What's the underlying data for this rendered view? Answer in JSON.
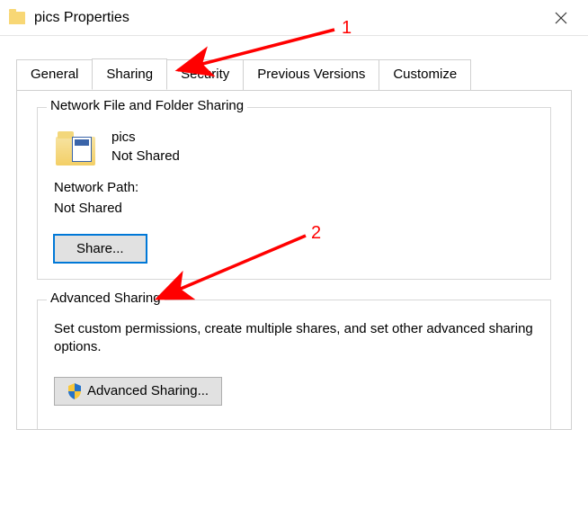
{
  "window": {
    "title": "pics Properties"
  },
  "tabs": {
    "general": "General",
    "sharing": "Sharing",
    "security": "Security",
    "previous": "Previous Versions",
    "customize": "Customize"
  },
  "network_group": {
    "legend": "Network File and Folder Sharing",
    "folder_name": "pics",
    "share_status": "Not Shared",
    "path_label": "Network Path:",
    "path_value": "Not Shared",
    "share_button": "Share..."
  },
  "advanced_group": {
    "legend": "Advanced Sharing",
    "description": "Set custom permissions, create multiple shares, and set other advanced sharing options.",
    "button": "Advanced Sharing..."
  },
  "annotations": {
    "one": "1",
    "two": "2"
  }
}
